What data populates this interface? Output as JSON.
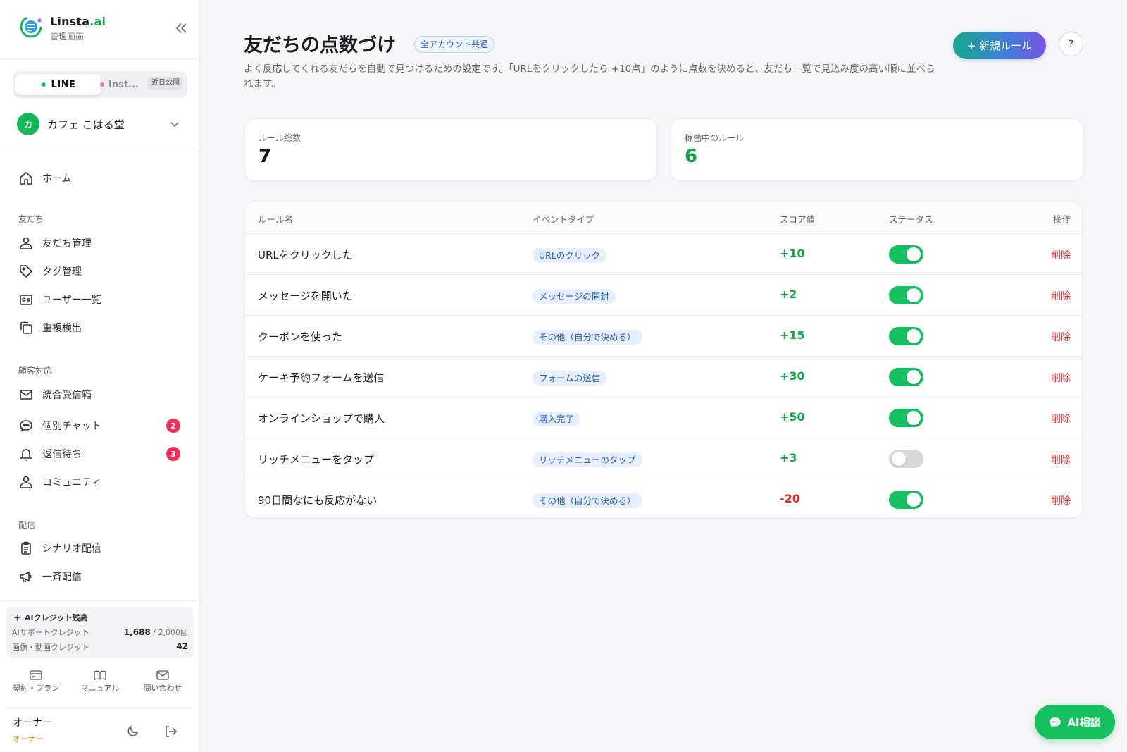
{
  "brand": {
    "name_main": "Linsta",
    "name_accent": ".ai",
    "subtitle": "管理画面"
  },
  "channels": {
    "line": "LINE",
    "instagram": "Inst...",
    "soon_badge": "近日公開"
  },
  "account": {
    "avatar_letter": "カ",
    "name": "カフェ こはる堂"
  },
  "nav": {
    "home": "ホーム",
    "section_friends": "友だち",
    "friends_manage": "友だち管理",
    "tags": "タグ管理",
    "users": "ユーザー一覧",
    "duplicates": "重複検出",
    "section_support": "顧客対応",
    "inbox": "統合受信箱",
    "chat": "個別チャット",
    "chat_badge": "2",
    "waiting": "返信待ち",
    "waiting_badge": "3",
    "community": "コミュニティ",
    "section_delivery": "配信",
    "scenario": "シナリオ配信",
    "broadcast": "一斉配信"
  },
  "credits": {
    "title": "AIクレジット残高",
    "support_label": "AIサポートクレジット",
    "support_used": "1,688",
    "support_total": " / 2,000回",
    "media_label": "画像・動画クレジット",
    "media_value": "42"
  },
  "footer_links": {
    "plan": "契約・プラン",
    "manual": "マニュアル",
    "contact": "問い合わせ"
  },
  "user": {
    "name": "オーナー",
    "role": "オーナー"
  },
  "page": {
    "title": "友だちの点数づけ",
    "scope_badge": "全アカウント共通",
    "description": "よく反応してくれる友だちを自動で見つけるための設定です。「URLをクリックしたら +10点」のように点数を決めると、友だち一覧で見込み度の高い順に並べられます。",
    "new_rule_button": "+ 新規ルール",
    "help_button": "?"
  },
  "stats": {
    "total_label": "ルール総数",
    "total_value": "7",
    "active_label": "稼働中のルール",
    "active_value": "6"
  },
  "table": {
    "headers": {
      "name": "ルール名",
      "event": "イベントタイプ",
      "score": "スコア値",
      "status": "ステータス",
      "action": "操作"
    },
    "rows": [
      {
        "name": "URLをクリックした",
        "event": "URLのクリック",
        "score": "+10",
        "enabled": true,
        "delete": "削除"
      },
      {
        "name": "メッセージを開いた",
        "event": "メッセージの開封",
        "score": "+2",
        "enabled": true,
        "delete": "削除"
      },
      {
        "name": "クーポンを使った",
        "event": "その他（自分で決める）",
        "score": "+15",
        "enabled": true,
        "delete": "削除"
      },
      {
        "name": "ケーキ予約フォームを送信",
        "event": "フォームの送信",
        "score": "+30",
        "enabled": true,
        "delete": "削除"
      },
      {
        "name": "オンラインショップで購入",
        "event": "購入完了",
        "score": "+50",
        "enabled": true,
        "delete": "削除"
      },
      {
        "name": "リッチメニューをタップ",
        "event": "リッチメニューのタップ",
        "score": "+3",
        "enabled": false,
        "delete": "削除"
      },
      {
        "name": "90日間なにも反応がない",
        "event": "その他（自分で決める）",
        "score": "-20",
        "enabled": true,
        "delete": "削除"
      }
    ]
  },
  "ai_button": "AI相談",
  "colors": {
    "accent_green": "#16c060",
    "danger": "#e03030",
    "badge_blue": "#2a5db8"
  }
}
